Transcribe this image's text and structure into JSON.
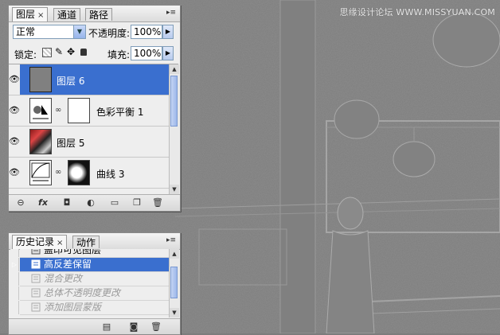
{
  "watermark": "思缘设计论坛 WWW.MISSYUAN.COM",
  "layers_panel": {
    "tabs": [
      {
        "label": "图层",
        "close": "×"
      },
      {
        "label": "通道"
      },
      {
        "label": "路径"
      }
    ],
    "blend_mode": "正常",
    "opacity_label": "不透明度:",
    "opacity_value": "100%",
    "lock_label": "锁定:",
    "fill_label": "填充:",
    "fill_value": "100%",
    "layers": [
      {
        "name": "图层 6",
        "selected": true
      },
      {
        "name": "色彩平衡 1"
      },
      {
        "name": "图层 5"
      },
      {
        "name": "曲线 3"
      }
    ],
    "footer_icons": [
      "link-icon",
      "fx-icon",
      "mask-icon",
      "adjustment-icon",
      "folder-icon",
      "new-layer-icon",
      "trash-icon"
    ]
  },
  "history_panel": {
    "tabs": [
      {
        "label": "历史记录",
        "close": "×"
      },
      {
        "label": "动作"
      }
    ],
    "items": [
      {
        "label": "盖印可见图层",
        "state": "normal"
      },
      {
        "label": "高反差保留",
        "state": "selected"
      },
      {
        "label": "混合更改",
        "state": "dim"
      },
      {
        "label": "总体不透明度更改",
        "state": "dim"
      },
      {
        "label": "添加图层蒙版",
        "state": "dim"
      }
    ]
  },
  "colors": {
    "selection": "#3a6fcf",
    "panel_bg": "#eeeeee",
    "canvas": "#7c7c7c"
  }
}
